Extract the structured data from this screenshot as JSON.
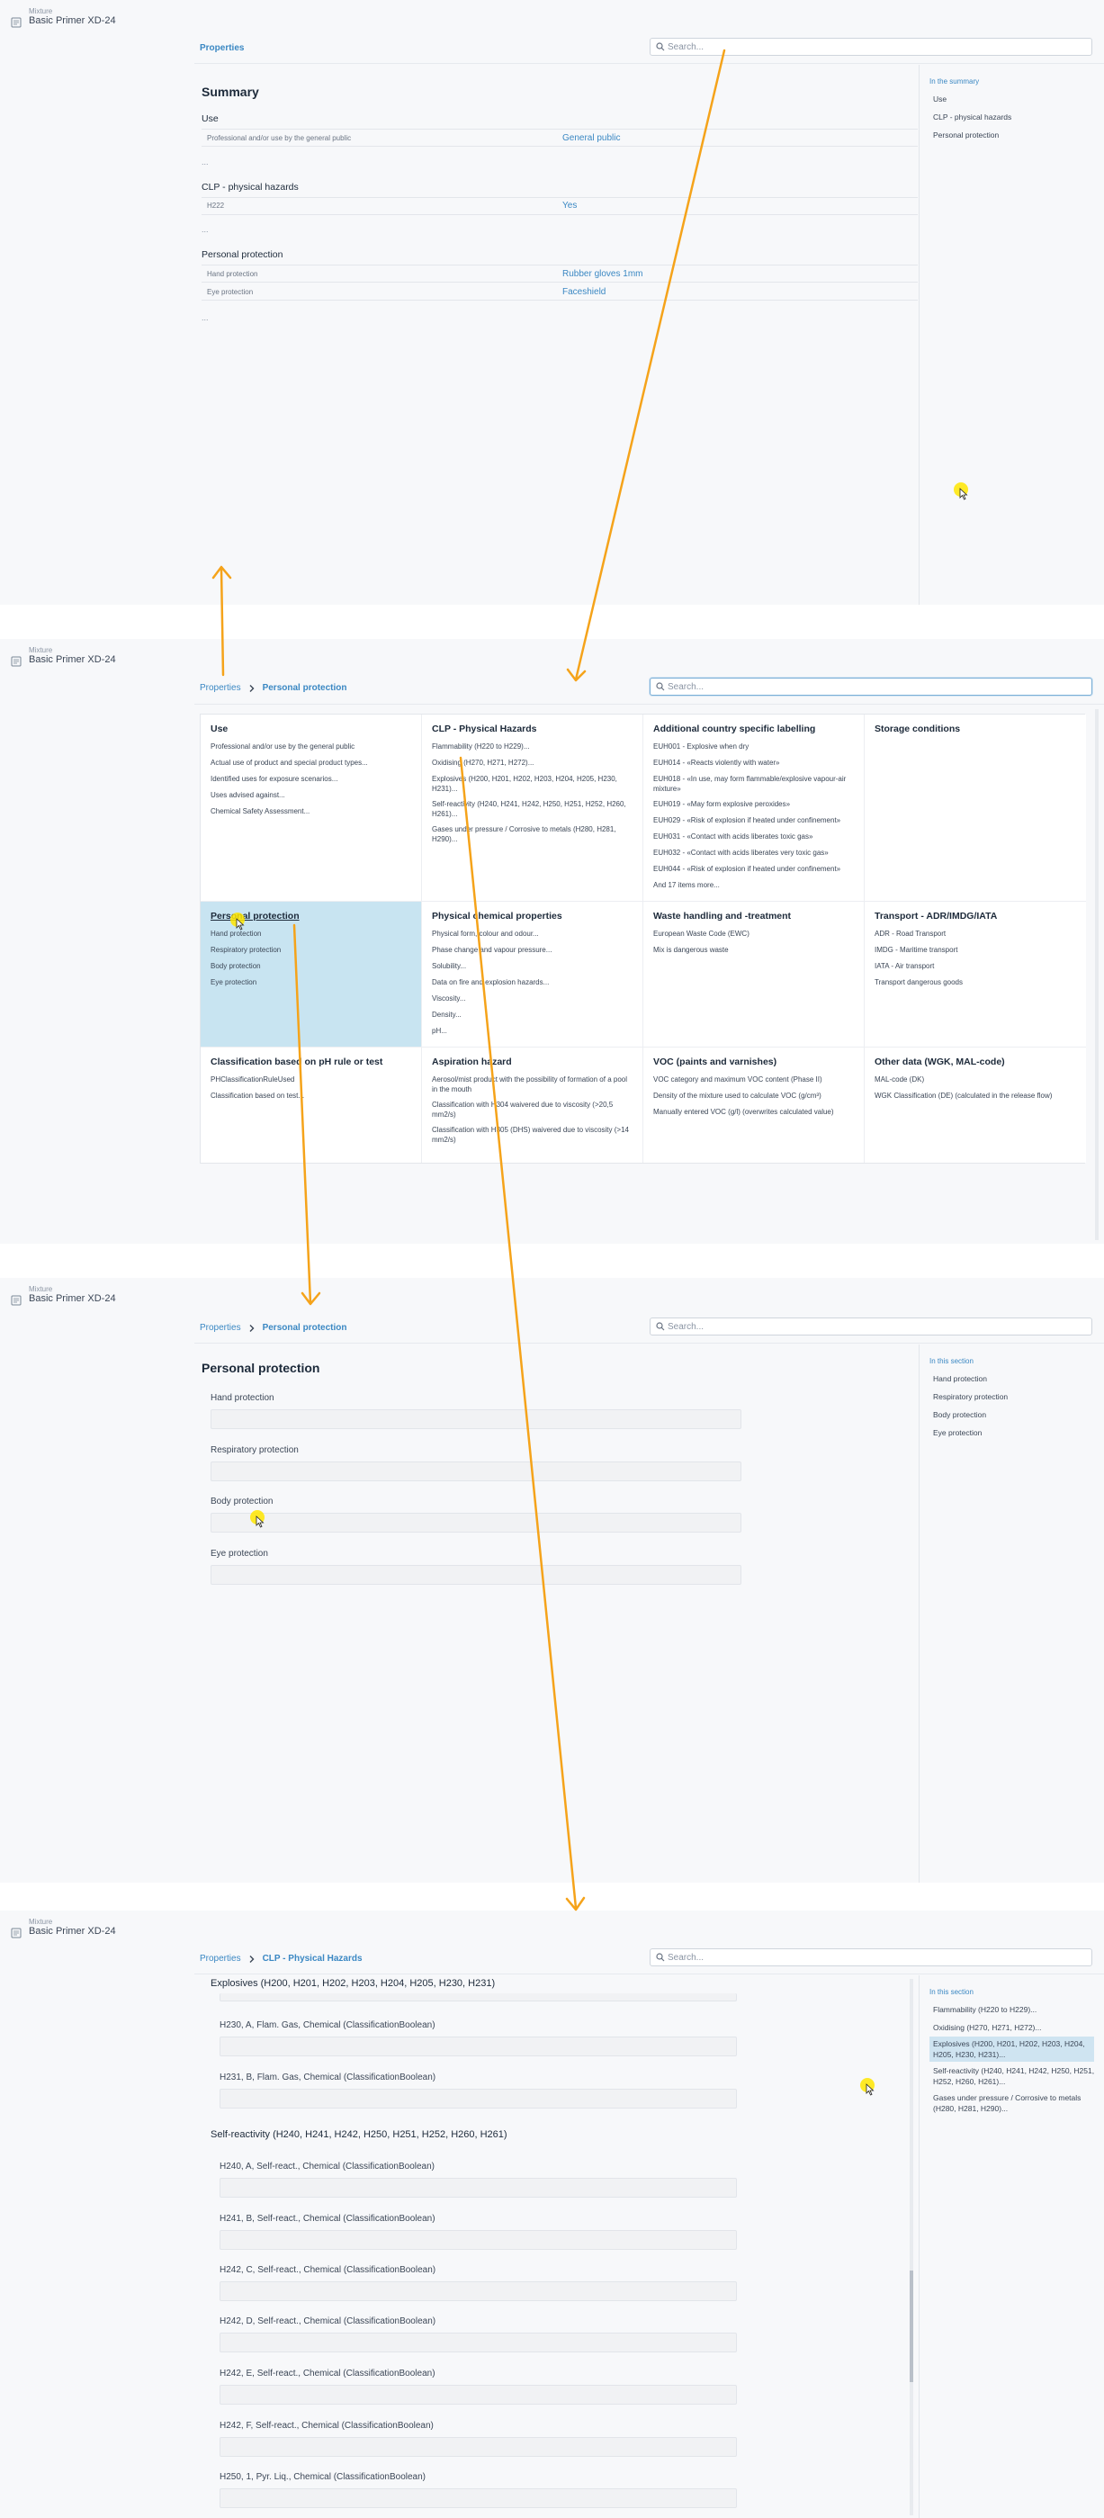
{
  "header": {
    "type_label": "Mixture",
    "name": "Basic Primer XD-24"
  },
  "accent_color": "#3b88c3",
  "arrow_color": "#f5a31a",
  "search": {
    "placeholder": "Search..."
  },
  "panel1": {
    "breadcrumb": {
      "root": "Properties"
    },
    "title": "Summary",
    "groups": [
      {
        "title": "Use",
        "rows": [
          {
            "label": "Professional and/or use by the general public",
            "value": "General public"
          }
        ],
        "more": "..."
      },
      {
        "title": "CLP - physical hazards",
        "rows": [
          {
            "label": "H222",
            "value": "Yes"
          }
        ],
        "more": "..."
      },
      {
        "title": "Personal protection",
        "rows": [
          {
            "label": "Hand protection",
            "value": "Rubber gloves 1mm"
          },
          {
            "label": "Eye protection",
            "value": "Faceshield"
          }
        ],
        "more": "..."
      }
    ],
    "toc": {
      "heading": "In the summary",
      "items": [
        "Use",
        "CLP - physical hazards",
        "Personal protection"
      ]
    }
  },
  "panel2": {
    "breadcrumb": {
      "root": "Properties",
      "current": "Personal protection"
    },
    "tiles": [
      {
        "title": "Use",
        "items": [
          "Professional and/or use by the general public",
          "Actual use of product and special product types...",
          "Identified uses for exposure scenarios...",
          "Uses advised against...",
          "Chemical Safety Assessment..."
        ]
      },
      {
        "title": "CLP - Physical Hazards",
        "items": [
          "Flammability (H220 to H229)...",
          "Oxidising (H270, H271, H272)...",
          "Explosives (H200, H201, H202, H203, H204, H205, H230, H231)...",
          "Self-reactivity (H240, H241, H242, H250, H251, H252, H260, H261)...",
          "Gases under pressure / Corrosive to metals (H280, H281, H290)..."
        ]
      },
      {
        "title": "Additional country specific labelling",
        "items": [
          "EUH001 - Explosive when dry",
          "EUH014 - «Reacts violently with water»",
          "EUH018 - «In use, may form flammable/explosive vapour-air mixture»",
          "EUH019 - «May form explosive peroxides»",
          "EUH029 - «Risk of explosion if heated under confinement»",
          "EUH031 - «Contact with acids liberates toxic gas»",
          "EUH032 - «Contact with acids liberates very toxic gas»",
          "EUH044 - «Risk of explosion if heated under confinement»",
          "And 17 items more..."
        ]
      },
      {
        "title": "Storage conditions",
        "items": []
      },
      {
        "title": "Personal protection",
        "items": [
          "Hand protection",
          "Respiratory protection",
          "Body protection",
          "Eye protection"
        ]
      },
      {
        "title": "Physical chemical properties",
        "items": [
          "Physical form, colour and odour...",
          "Phase change and vapour pressure...",
          "Solubility...",
          "Data on fire and explosion hazards...",
          "Viscosity...",
          "Density...",
          "pH..."
        ]
      },
      {
        "title": "Waste handling and -treatment",
        "items": [
          "European Waste Code (EWC)",
          "Mix is dangerous waste"
        ]
      },
      {
        "title": "Transport - ADR/IMDG/IATA",
        "items": [
          "ADR - Road Transport",
          "IMDG - Maritime transport",
          "IATA - Air transport",
          "Transport dangerous goods"
        ]
      },
      {
        "title": "Classification based on pH rule or test",
        "items": [
          "PHClassificationRuleUsed",
          "Classification based on test..."
        ]
      },
      {
        "title": "Aspiration hazard",
        "items": [
          "Aerosol/mist product with the possibility of formation of a pool in the mouth",
          "Classification with H304 waivered due to viscosity (>20,5 mm2/s)",
          "Classification with H305 (DHS) waivered due to viscosity (>14 mm2/s)"
        ]
      },
      {
        "title": "VOC (paints and varnishes)",
        "items": [
          "VOC category and maximum VOC content (Phase II)",
          "Density of the mixture used to calculate VOC (g/cm³)",
          "Manually entered VOC (g/l) (overwrites calculated value)"
        ]
      },
      {
        "title": "Other data (WGK, MAL-code)",
        "items": [
          "MAL-code (DK)",
          "WGK Classification (DE) (calculated in the release flow)"
        ]
      }
    ]
  },
  "panel3": {
    "breadcrumb": {
      "root": "Properties",
      "current": "Personal protection"
    },
    "title": "Personal protection",
    "fields": [
      "Hand protection",
      "Respiratory protection",
      "Body protection",
      "Eye protection"
    ],
    "toc": {
      "heading": "In this section",
      "items": [
        "Hand protection",
        "Respiratory protection",
        "Body protection",
        "Eye protection"
      ]
    }
  },
  "panel4": {
    "breadcrumb": {
      "root": "Properties",
      "current": "CLP - Physical Hazards"
    },
    "group1": {
      "title": "Explosives (H200, H201, H202, H203, H204, H205, H230, H231)",
      "fields": [
        "H230, A, Flam. Gas, Chemical (ClassificationBoolean)",
        "H231, B, Flam. Gas, Chemical (ClassificationBoolean)"
      ]
    },
    "group2": {
      "title": "Self-reactivity (H240, H241, H242, H250, H251, H252, H260, H261)",
      "fields": [
        "H240, A, Self-react., Chemical (ClassificationBoolean)",
        "H241, B, Self-react., Chemical (ClassificationBoolean)",
        "H242, C, Self-react., Chemical (ClassificationBoolean)",
        "H242, D, Self-react., Chemical (ClassificationBoolean)",
        "H242, E, Self-react., Chemical (ClassificationBoolean)",
        "H242, F, Self-react., Chemical (ClassificationBoolean)",
        "H250, 1, Pyr. Liq., Chemical (ClassificationBoolean)"
      ]
    },
    "toc": {
      "heading": "In this section",
      "items": [
        "Flammability (H220 to H229)...",
        "Oxidising (H270, H271, H272)...",
        "Explosives (H200, H201, H202, H203, H204, H205, H230, H231)...",
        "Self-reactivity (H240, H241, H242, H250, H251, H252, H260, H261)...",
        "Gases under pressure / Corrosive to metals (H280, H281, H290)..."
      ]
    }
  }
}
